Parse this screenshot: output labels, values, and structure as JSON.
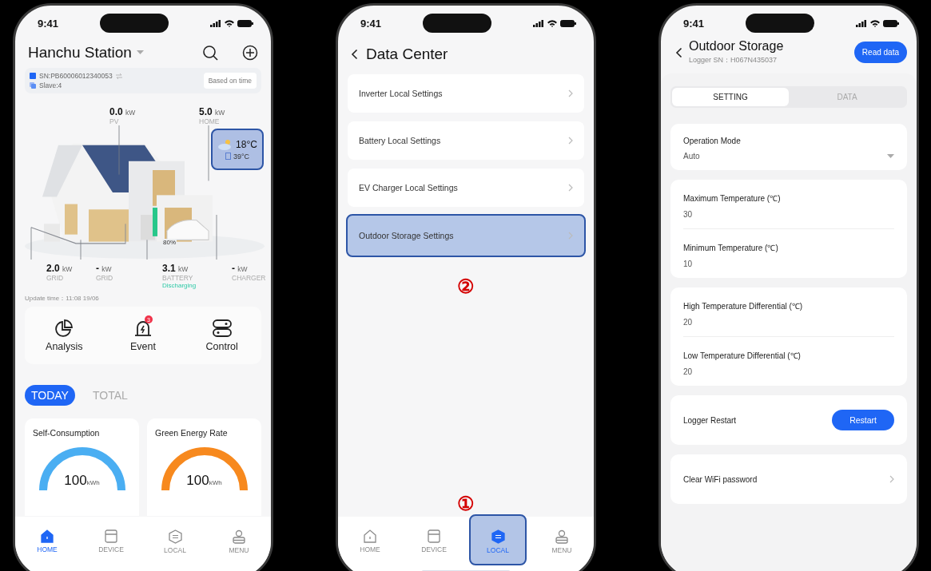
{
  "home_screen": {
    "status_time": "9:41",
    "station": "Hanchu Station",
    "sn": "SN:PB60006012340053",
    "slave": "Slave:4",
    "mode_button": "Based on time",
    "top_flows": [
      {
        "value": "0.0",
        "unit": "kW",
        "label": "PV"
      },
      {
        "value": "5.0",
        "unit": "kW",
        "label": "HOME"
      }
    ],
    "weather": {
      "outdoor": "18°C",
      "indoor": "39°C",
      "highlighted": true
    },
    "battery_soc": "80%",
    "bottom_flows": [
      {
        "value": "2.0",
        "unit": "kW",
        "label": "GRID"
      },
      {
        "value": "-",
        "unit": "kW",
        "label": "GRID"
      },
      {
        "value": "3.1",
        "unit": "kW",
        "label": "BATTERY",
        "status": "Discharging"
      },
      {
        "value": "-",
        "unit": "kW",
        "label": "CHARGER"
      }
    ],
    "update_time": "Update time：11:08 19/06",
    "actions": [
      {
        "label": "Analysis"
      },
      {
        "label": "Event",
        "badge": "3"
      },
      {
        "label": "Control"
      }
    ],
    "period_tabs": [
      {
        "label": "TODAY",
        "selected": true
      },
      {
        "label": "TOTAL",
        "selected": false
      }
    ],
    "stat_cards": [
      {
        "title": "Self-Consumption",
        "value": "100",
        "unit": "kWh",
        "color": "#4aaef2"
      },
      {
        "title": "Green Energy Rate",
        "value": "100",
        "unit": "kWh",
        "color": "#f7891e"
      }
    ],
    "nav": [
      {
        "label": "HOME",
        "selected": true,
        "highlighted": false
      },
      {
        "label": "DEVICE",
        "selected": false,
        "highlighted": false
      },
      {
        "label": "LOCAL",
        "selected": false,
        "highlighted": false
      },
      {
        "label": "MENU",
        "selected": false,
        "highlighted": false
      }
    ]
  },
  "data_center_screen": {
    "status_time": "9:41",
    "title": "Data Center",
    "items": [
      {
        "label": "Inverter Local Settings",
        "highlighted": false
      },
      {
        "label": "Battery Local Settings",
        "highlighted": false
      },
      {
        "label": "EV Charger Local Settings",
        "highlighted": false
      },
      {
        "label": "Outdoor Storage Settings",
        "highlighted": true
      }
    ],
    "step_marks": [
      "②",
      "①"
    ],
    "nav": [
      {
        "label": "HOME",
        "selected": false,
        "highlighted": false
      },
      {
        "label": "DEVICE",
        "selected": false,
        "highlighted": false
      },
      {
        "label": "LOCAL",
        "selected": true,
        "highlighted": true
      },
      {
        "label": "MENU",
        "selected": false,
        "highlighted": false
      }
    ]
  },
  "outdoor_storage_screen": {
    "status_time": "9:41",
    "title": "Outdoor Storage",
    "subtitle": "Logger SN：H067N435037",
    "read_button": "Read data",
    "tabs": [
      {
        "label": "SETTING",
        "selected": true
      },
      {
        "label": "DATA",
        "selected": false
      }
    ],
    "cards": [
      {
        "kind": "dropdown",
        "fields": [
          {
            "label": "Operation Mode",
            "value": "Auto"
          }
        ]
      },
      {
        "kind": "fields",
        "fields": [
          {
            "label": "Maximum Temperature (℃)",
            "value": "30"
          },
          {
            "label": "Minimum Temperature (℃)",
            "value": "10"
          }
        ]
      },
      {
        "kind": "fields",
        "fields": [
          {
            "label": "High Temperature Differential (℃)",
            "value": "20"
          },
          {
            "label": "Low Temperature Differential (℃)",
            "value": "20"
          }
        ]
      },
      {
        "kind": "button",
        "label": "Logger Restart",
        "button": "Restart"
      },
      {
        "kind": "link",
        "label": "Clear WiFi password"
      }
    ]
  }
}
